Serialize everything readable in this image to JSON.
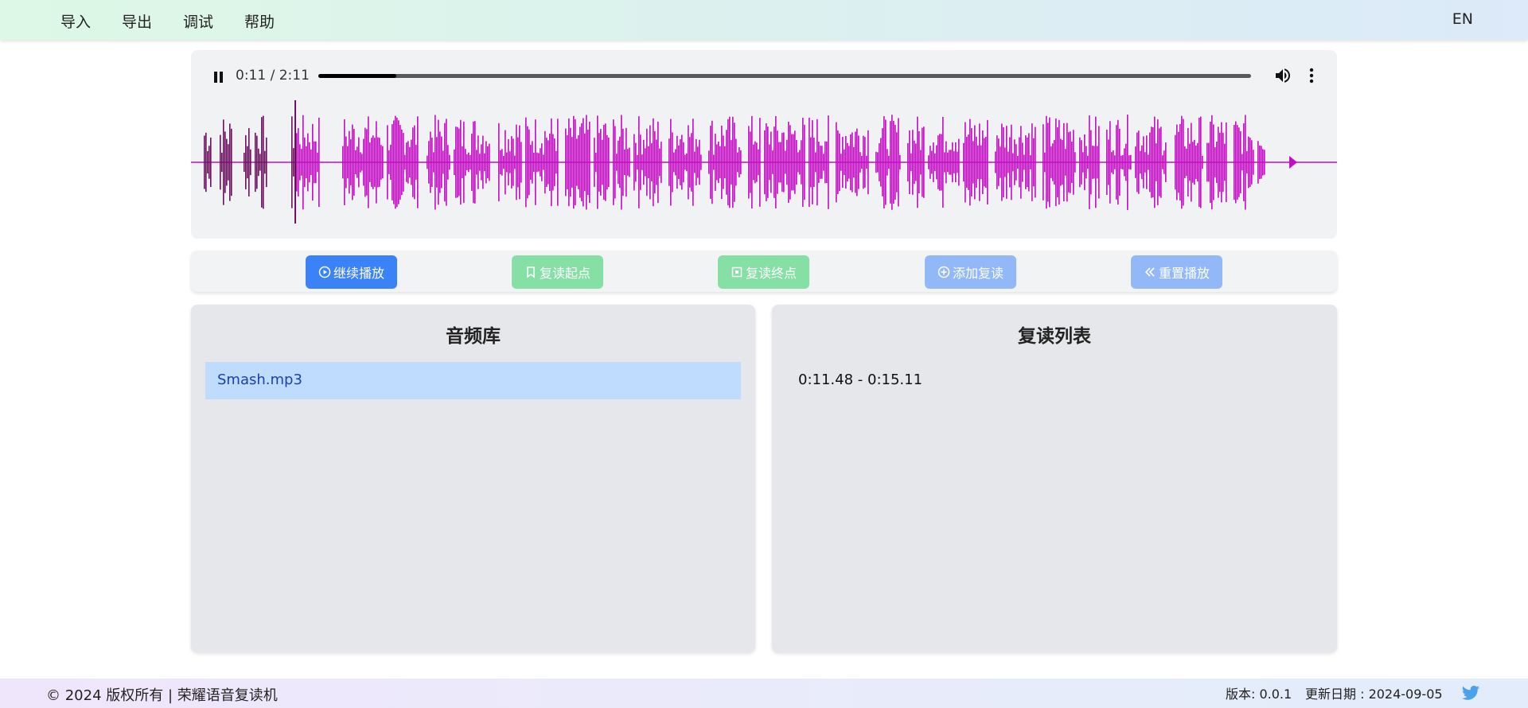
{
  "nav": {
    "items": [
      "导入",
      "导出",
      "调试",
      "帮助"
    ],
    "language": "EN"
  },
  "player": {
    "time": "0:11 / 2:11",
    "progress_fraction": 0.084,
    "waveform_cursor_fraction": 0.091,
    "waveform_played_color": "#6b0f5e",
    "waveform_unplayed_color": "#c40cc4",
    "icons": {
      "pause": "pause-icon",
      "volume": "volume-icon",
      "more": "more-vert-icon"
    }
  },
  "controls": {
    "continue_play": "继续播放",
    "repeat_start": "复读起点",
    "repeat_end": "复读终点",
    "add_repeat": "添加复读",
    "reset_play": "重置播放",
    "colors": {
      "primary": "#3b82f6",
      "success": "#86dfa5",
      "disabled": "#93b8f8"
    }
  },
  "library": {
    "title": "音频库",
    "items": [
      "Smash.mp3"
    ]
  },
  "repeat_list": {
    "title": "复读列表",
    "items": [
      "0:11.48 - 0:15.11"
    ]
  },
  "footer": {
    "copyright": "© 2024 版权所有 | 荣耀语音复读机",
    "version": "版本: 0.0.1",
    "update_date": "更新日期 : 2024-09-05"
  }
}
